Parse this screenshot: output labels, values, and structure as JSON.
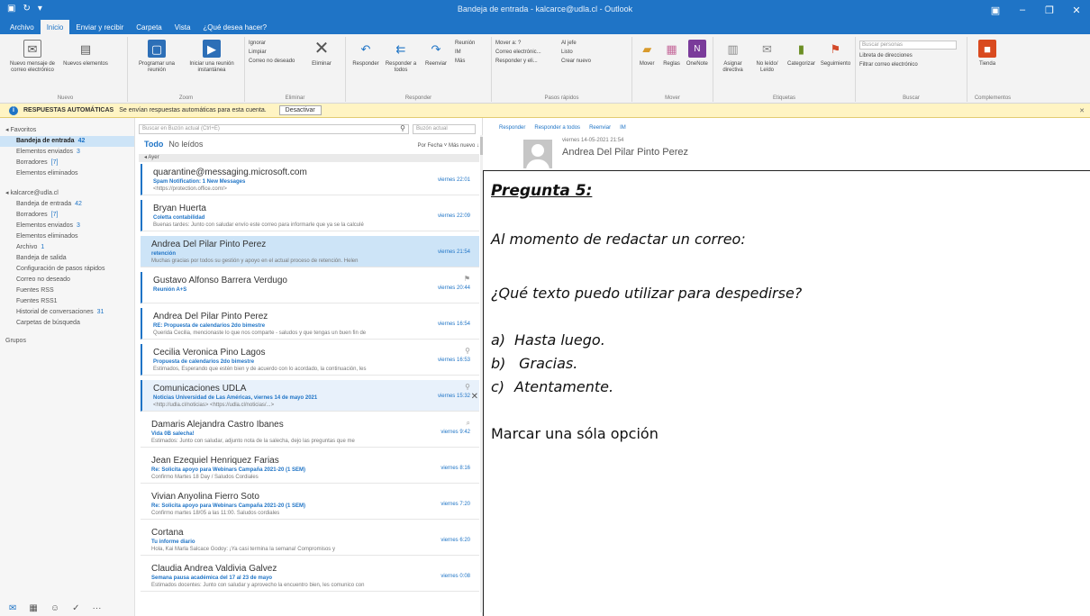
{
  "window": {
    "title": "Bandeja de entrada - kalcarce@udla.cl - Outlook"
  },
  "menu_tabs": [
    "Archivo",
    "Inicio",
    "Enviar y recibir",
    "Carpeta",
    "Vista",
    "¿Qué desea hacer?"
  ],
  "ribbon": {
    "groups": [
      {
        "label": "Nuevo",
        "buttons": [
          "Nuevo mensaje de correo electrónico",
          "Nuevos elementos"
        ]
      },
      {
        "label": "Zoom",
        "buttons": [
          "Programar una reunión",
          "Iniciar una reunión instantánea"
        ]
      },
      {
        "label": "Eliminar",
        "buttons": [
          "Eliminar"
        ],
        "small": [
          "Ignorar",
          "Limpiar",
          "Correo no deseado"
        ]
      },
      {
        "label": "Responder",
        "buttons": [
          "Responder",
          "Responder a todos",
          "Reenviar"
        ],
        "small": [
          "Reunión",
          "IM",
          "Más"
        ]
      },
      {
        "label": "Pasos rápidos",
        "small": [
          "Mover a: ?",
          "Correo electrónic...",
          "Responder y eli...",
          "Al jefe",
          "Listo",
          "Crear nuevo"
        ]
      },
      {
        "label": "Mover",
        "buttons": [
          "Mover",
          "Reglas",
          "OneNote"
        ]
      },
      {
        "label": "Etiquetas",
        "buttons": [
          "Asignar directiva",
          "No leído/ Leído",
          "Categorizar",
          "Seguimiento"
        ]
      },
      {
        "label": "Buscar",
        "small": [
          "Buscar personas",
          "Libreta de direcciones",
          "Filtrar correo electrónico"
        ]
      },
      {
        "label": "Complementos",
        "buttons": [
          "Tienda"
        ]
      }
    ]
  },
  "infobar": {
    "label": "RESPUESTAS AUTOMÁTICAS",
    "text": "Se envían respuestas automáticas para esta cuenta.",
    "button": "Desactivar"
  },
  "folders": {
    "favorites_header": "◂ Favoritos",
    "favorites": [
      {
        "name": "Bandeja de entrada",
        "count": "42",
        "selected": true
      },
      {
        "name": "Elementos enviados",
        "count": "3"
      },
      {
        "name": "Borradores",
        "count": "[7]"
      },
      {
        "name": "Elementos eliminados",
        "count": ""
      }
    ],
    "account_header": "◂ kalcarce@udla.cl",
    "account": [
      {
        "name": "Bandeja de entrada",
        "count": "42"
      },
      {
        "name": "Borradores",
        "count": "[7]"
      },
      {
        "name": "Elementos enviados",
        "count": "3"
      },
      {
        "name": "Elementos eliminados",
        "count": ""
      },
      {
        "name": "Archivo",
        "count": "1"
      },
      {
        "name": "Bandeja de salida",
        "count": ""
      },
      {
        "name": "Configuración de pasos rápidos",
        "count": ""
      },
      {
        "name": "Correo no deseado",
        "count": ""
      },
      {
        "name": "Fuentes RSS",
        "count": ""
      },
      {
        "name": "Fuentes RSS1",
        "count": ""
      },
      {
        "name": "Historial de conversaciones",
        "count": "31"
      },
      {
        "name": "Carpetas de búsqueda",
        "count": ""
      }
    ],
    "groups_header": "Grupos"
  },
  "message_list": {
    "search_placeholder": "Buscar en Buzón actual (Ctrl+E)",
    "search_scope": "Buzón actual",
    "filter_all": "Todo",
    "filter_unread": "No leídos",
    "sort": "Por Fecha ˅   Más nuevo ↓",
    "group_header": "◂ Ayer",
    "messages": [
      {
        "sender": "quarantine@messaging.microsoft.com",
        "subject": "Spam Notification: 1 New Messages",
        "preview": "<https://protection.office.com/>",
        "date": "viernes 22:01"
      },
      {
        "sender": "Bryan Huerta",
        "subject": "Coletta contabilidad",
        "preview": "Buenas tardes: Junto con saludar envío este correo para informarle que ya se la calculé",
        "date": "viernes 22:09"
      },
      {
        "sender": "Andrea Del Pilar Pinto Perez",
        "subject": "retención",
        "preview": "Muchas gracias por todos su gestión y apoyo en el actual proceso de retención. Helen",
        "date": "viernes 21:54"
      },
      {
        "sender": "Gustavo Alfonso Barrera Verdugo",
        "subject": "Reunión A+S",
        "preview": "",
        "date": "viernes 20:44"
      },
      {
        "sender": "Andrea Del Pilar Pinto Perez",
        "subject": "RE: Propuesta de calendarios 2do bimestre",
        "preview": "Querida Cecilia, mencionaste lo que nos comparte - saludos y que tengas un buen fin de",
        "date": "viernes 16:54"
      },
      {
        "sender": "Cecilia Veronica Pino Lagos",
        "subject": "Propuesta de calendarios 2do bimestre",
        "preview": "Estimados, Esperando que estén bien y de acuerdo con lo acordado, la continuación, les",
        "date": "viernes 16:53"
      },
      {
        "sender": "Comunicaciones UDLA",
        "subject": "Noticias Universidad de Las Américas, viernes 14 de mayo 2021",
        "preview": "<http://udla.cl/noticias> <https://udla.cl/noticias/...>",
        "date": "viernes 15:32"
      },
      {
        "sender": "Damaris Alejandra Castro Ibanes",
        "subject": "Vida 0B salecha!",
        "preview": "Estimados: Junto con saludar, adjunto nota de la salecha, dejo las preguntas que me",
        "date": "viernes 9:42"
      },
      {
        "sender": "Jean Ezequiel Henriquez Farias",
        "subject": "Re: Solicita apoyo para Webinars Campaña 2021-20 (1 SEM)",
        "preview": "Confirmo Martes 18 Day / Saludos Cordiales",
        "date": "viernes 8:16"
      },
      {
        "sender": "Vivian Anyolina Fierro Soto",
        "subject": "Re: Solicita apoyo para Webinars Campaña 2021-20 (1 SEM)",
        "preview": "Confirmo martes 18/05 a las 11:00. Saludos cordiales",
        "date": "viernes 7:20"
      },
      {
        "sender": "Cortana",
        "subject": "Tu informe diario",
        "preview": "Hola, Kai Marla Salcace Godoy: ¡Ya casi termina la semana! Compromisos y",
        "date": "viernes 6:20"
      },
      {
        "sender": "Claudia Andrea Valdivia Galvez",
        "subject": "Semana pausa académica del 17 al 23 de mayo",
        "preview": "Estimados docentes: Junto con saludar y aprovecho la encuentro bien, les comunico con",
        "date": "viernes 0:08"
      }
    ]
  },
  "reading_pane": {
    "toolbar": [
      "Responder",
      "Responder a todos",
      "Reenviar",
      "IM"
    ],
    "date": "viernes 14-05-2021 21:54",
    "sender": "Andrea Del Pilar Pinto Perez"
  },
  "question": {
    "title": "Pregunta 5:",
    "intro": "Al momento de redactar un correo:",
    "ask": "¿Qué texto puedo utilizar para despedirse?",
    "options": [
      {
        "letter": "a)",
        "text": "Hasta luego."
      },
      {
        "letter": "b)",
        "text": " Gracias."
      },
      {
        "letter": "c)",
        "text": "Atentamente."
      }
    ],
    "note": "Marcar una sóla opción"
  },
  "colors": {
    "accent": "#1f74c6",
    "selected_bg": "#cde4f7",
    "infobar_bg": "#fff4c3"
  }
}
